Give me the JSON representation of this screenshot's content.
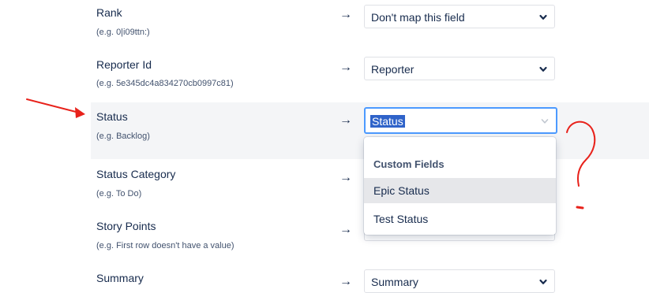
{
  "rows": [
    {
      "name": "Rank",
      "example": "(e.g. 0|i09ttn:)",
      "arrow": "→",
      "value": "Don't map this field"
    },
    {
      "name": "Reporter Id",
      "example": "(e.g. 5e345dc4a834270cb0997c81)",
      "arrow": "→",
      "value": "Reporter"
    },
    {
      "name": "Status",
      "example": "(e.g. Backlog)",
      "arrow": "→",
      "value": "Status"
    },
    {
      "name": "Status Category",
      "example": "(e.g. To Do)",
      "arrow": "→",
      "value": ""
    },
    {
      "name": "Story Points",
      "example": "(e.g. First row doesn't have a value)",
      "arrow": "→",
      "value": ""
    },
    {
      "name": "Summary",
      "example": "",
      "arrow": "→",
      "value": "Summary"
    }
  ],
  "dropdown": {
    "group_label": "Custom Fields",
    "options": [
      "Epic Status",
      "Test Status"
    ],
    "hovered_index": 0
  },
  "icons": {
    "select": "chevron-down-icon",
    "annotation_arrow": "red-arrow-annotation",
    "annotation_mark": "red-question-mark-annotation"
  },
  "colors": {
    "focus_border": "#4c9aff",
    "selection_highlight": "#2f63c9",
    "annotation": "#e8221b"
  }
}
